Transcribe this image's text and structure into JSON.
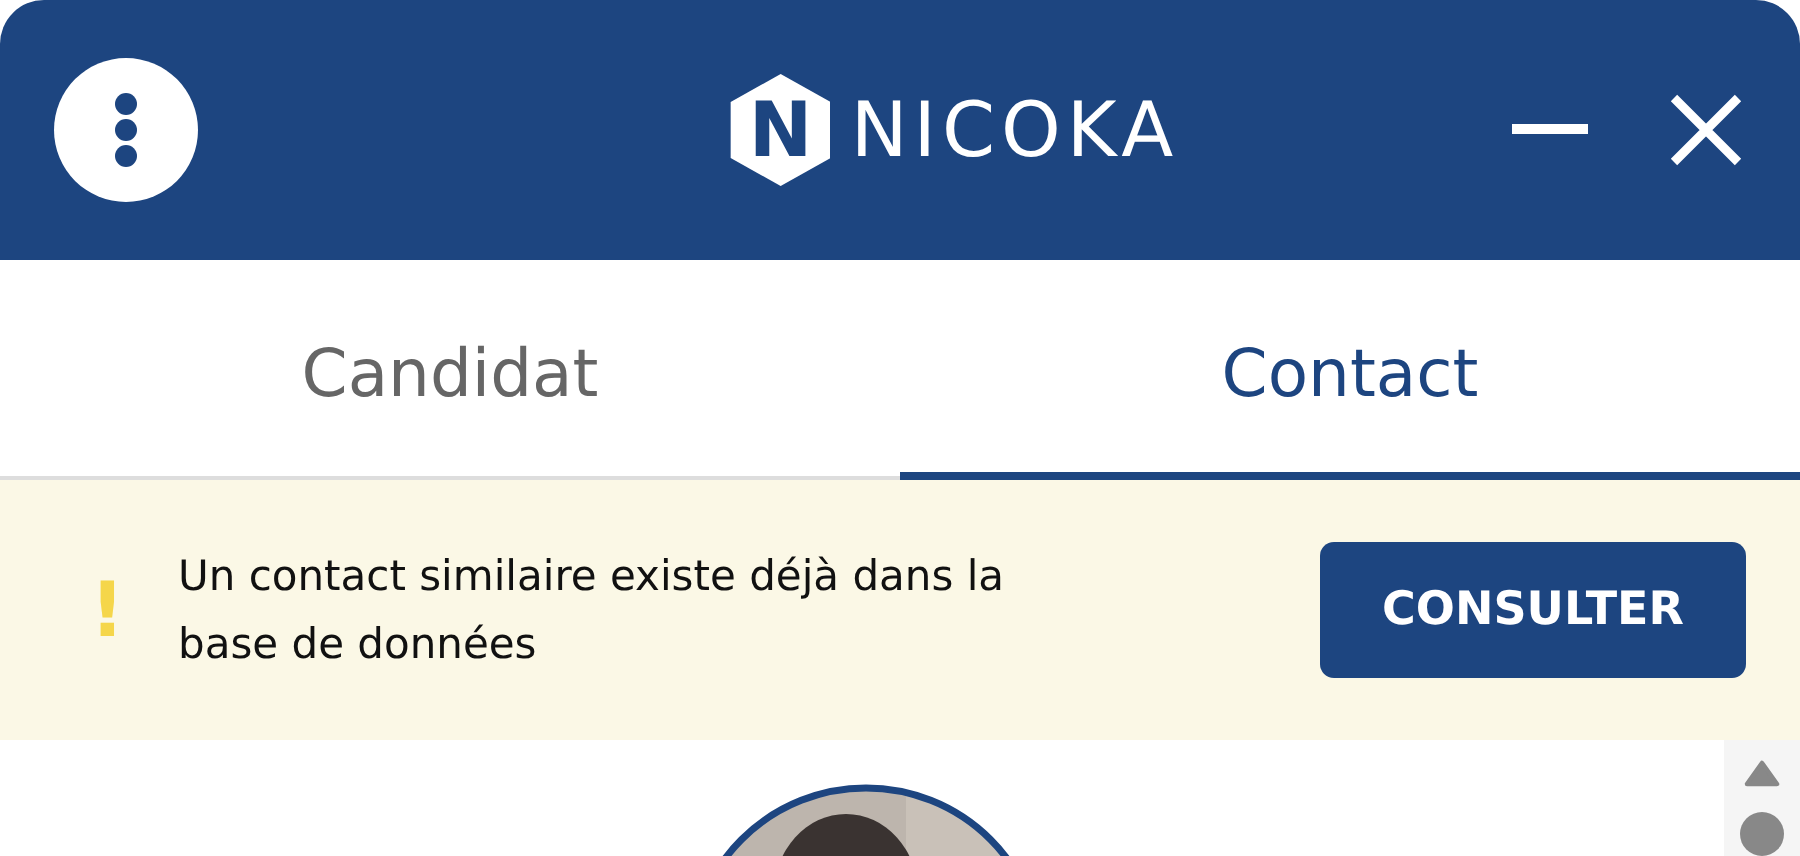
{
  "header": {
    "logo_mark": "N",
    "logo_text": "NICOKA"
  },
  "tabs": [
    {
      "label": "Candidat",
      "selected": false
    },
    {
      "label": "Contact",
      "selected": true
    }
  ],
  "alert": {
    "icon": "!",
    "message": "Un contact similaire existe déjà dans la base de données",
    "button": "CONSULTER"
  }
}
